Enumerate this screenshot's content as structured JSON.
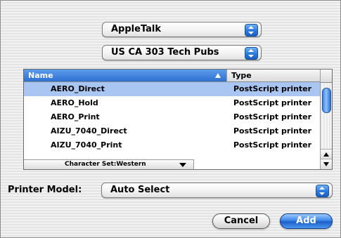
{
  "protocol_popup": {
    "value": "AppleTalk"
  },
  "zone_popup": {
    "value": "US CA 303 Tech Pubs"
  },
  "printer_list": {
    "columns": {
      "name": "Name",
      "type": "Type"
    },
    "rows": [
      {
        "name": "AERO_Direct",
        "type": "PostScript printer",
        "selected": true
      },
      {
        "name": "AERO_Hold",
        "type": "PostScript printer",
        "selected": false
      },
      {
        "name": "AERO_Print",
        "type": "PostScript printer",
        "selected": false
      },
      {
        "name": "AIZU_7040_Direct",
        "type": "PostScript printer",
        "selected": false
      },
      {
        "name": "AIZU_7040_Print",
        "type": "PostScript printer",
        "selected": false
      }
    ]
  },
  "character_set": {
    "value": "Character Set:Western"
  },
  "printer_model": {
    "label": "Printer Model:",
    "value": "Auto Select"
  },
  "buttons": {
    "cancel": "Cancel",
    "add": "Add"
  },
  "colors": {
    "accent": "#2f6fd0",
    "selection": "#a9c6f2"
  }
}
